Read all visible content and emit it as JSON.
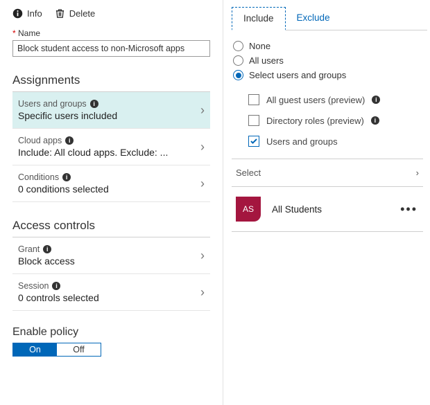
{
  "toolbar": {
    "info": "Info",
    "delete": "Delete"
  },
  "name_field": {
    "label": "Name",
    "value": "Block student access to non-Microsoft apps"
  },
  "sections": {
    "assignments": "Assignments",
    "access_controls": "Access controls",
    "enable_policy": "Enable policy"
  },
  "assignments": {
    "users": {
      "title": "Users and groups",
      "value": "Specific users included"
    },
    "apps": {
      "title": "Cloud apps",
      "value": "Include: All cloud apps. Exclude: ..."
    },
    "cond": {
      "title": "Conditions",
      "value": "0 conditions selected"
    }
  },
  "access": {
    "grant": {
      "title": "Grant",
      "value": "Block access"
    },
    "session": {
      "title": "Session",
      "value": "0 controls selected"
    }
  },
  "toggle": {
    "on": "On",
    "off": "Off"
  },
  "tabs": {
    "include": "Include",
    "exclude": "Exclude"
  },
  "radios": {
    "none": "None",
    "all": "All users",
    "select": "Select users and groups"
  },
  "checks": {
    "guest": "All guest users (preview)",
    "roles": "Directory roles (preview)",
    "ug": "Users and groups"
  },
  "select_label": "Select",
  "group": {
    "initials": "AS",
    "name": "All Students"
  }
}
